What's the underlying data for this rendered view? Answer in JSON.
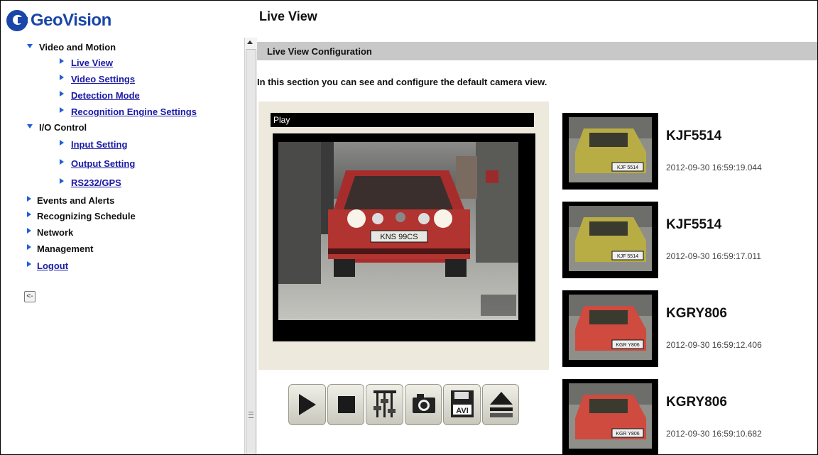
{
  "logo": {
    "text": "GeoVision"
  },
  "nav": {
    "video_and_motion": "Video and Motion",
    "live_view": "Live View",
    "video_settings": "Video Settings",
    "detection_mode": "Detection Mode",
    "recognition_engine_settings": "Recognition Engine Settings",
    "io_control": "I/O Control",
    "input_setting": "Input Setting",
    "output_setting": "Output Setting",
    "rs232_gps": "RS232/GPS",
    "events_and_alerts": "Events and Alerts",
    "recognizing_schedule": "Recognizing Schedule",
    "network": "Network",
    "management": "Management",
    "logout": "Logout",
    "collapse_label": "<-"
  },
  "main": {
    "title": "Live View",
    "section_header": "Live View Configuration",
    "description": "In this section you can see and configure the default camera view.",
    "play_label": "Play"
  },
  "video_plate_text": "KNS 99CS",
  "controls": [
    {
      "name": "play-button",
      "icon": "play-icon"
    },
    {
      "name": "stop-button",
      "icon": "stop-icon"
    },
    {
      "name": "adjust-button",
      "icon": "sliders-icon"
    },
    {
      "name": "snapshot-button",
      "icon": "camera-icon"
    },
    {
      "name": "record-avi-button",
      "icon": "avi-icon"
    },
    {
      "name": "eject-button",
      "icon": "eject-icon"
    }
  ],
  "recognitions": [
    {
      "plate": "KJF5514",
      "time": "2012-09-30 16:59:19.044",
      "thumb_text": "KJF 5514",
      "car_color": "#b8ad45"
    },
    {
      "plate": "KJF5514",
      "time": "2012-09-30 16:59:17.011",
      "thumb_text": "KJF 5514",
      "car_color": "#b8ad45"
    },
    {
      "plate": "KGRY806",
      "time": "2012-09-30 16:59:12.406",
      "thumb_text": "KGR Y806",
      "car_color": "#cf4a3f"
    },
    {
      "plate": "KGRY806",
      "time": "2012-09-30 16:59:10.682",
      "thumb_text": "KGR Y806",
      "car_color": "#cf4a3f"
    }
  ],
  "colors": {
    "link": "#1a1aa6",
    "arrow": "#1e5fd6",
    "header_bar": "#c8c8c8",
    "panel_bg": "#ede9dc"
  }
}
